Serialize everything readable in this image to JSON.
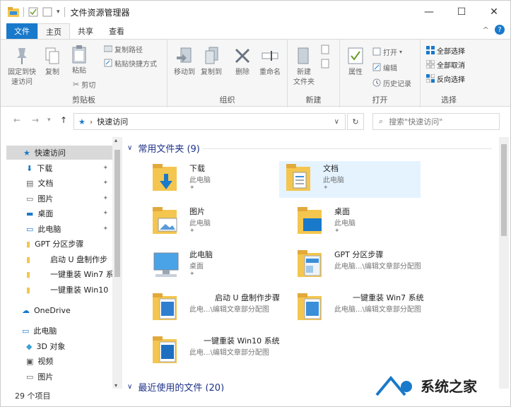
{
  "window": {
    "title": "文件资源管理器"
  },
  "tabs": [
    {
      "label": "文件"
    },
    {
      "label": "主页"
    },
    {
      "label": "共享"
    },
    {
      "label": "查看"
    }
  ],
  "ribbon": {
    "clipboard": {
      "pin": "固定到快\n速访问",
      "copy": "复制",
      "paste": "粘贴",
      "copy_path": "复制路径",
      "paste_shortcut": "粘贴快捷方式",
      "cut": "剪切",
      "label": "剪贴板"
    },
    "organize": {
      "move_to": "移动到",
      "copy_to": "复制到",
      "delete": "删除",
      "rename": "重命名",
      "label": "组织"
    },
    "new": {
      "new_folder": "新建\n文件夹",
      "label": "新建"
    },
    "open": {
      "properties": "属性",
      "open": "打开",
      "edit": "编辑",
      "history": "历史记录",
      "label": "打开"
    },
    "select": {
      "select_all": "全部选择",
      "select_none": "全部取消",
      "invert": "反向选择",
      "label": "选择"
    }
  },
  "address": {
    "path": "快速访问",
    "search_placeholder": "搜索\"快速访问\""
  },
  "nav": {
    "items": [
      {
        "label": "快速访问"
      },
      {
        "label": "下载"
      },
      {
        "label": "文档"
      },
      {
        "label": "图片"
      },
      {
        "label": "桌面"
      },
      {
        "label": "此电脑"
      },
      {
        "label": "GPT 分区步骤"
      },
      {
        "label": "启动 U 盘制作步"
      },
      {
        "label": "一键重装 Win7 系"
      },
      {
        "label": "一键重装 Win10"
      },
      {
        "label": "OneDrive"
      },
      {
        "label": "此电脑"
      },
      {
        "label": "3D 对象"
      },
      {
        "label": "视频"
      },
      {
        "label": "图片"
      }
    ]
  },
  "status": {
    "count": "29 个项目"
  },
  "content": {
    "section_title": "常用文件夹 (9)",
    "recent_title": "最近使用的文件 (20)",
    "tiles": [
      {
        "name": "下载",
        "sub": "此电脑"
      },
      {
        "name": "文档",
        "sub": "此电脑"
      },
      {
        "name": "图片",
        "sub": "此电脑"
      },
      {
        "name": "桌面",
        "sub": "此电脑"
      },
      {
        "name": "此电脑",
        "sub": "桌面"
      },
      {
        "name": "GPT 分区步骤",
        "sub": "此电脑...\\编辑文章部分配图"
      },
      {
        "name": "启动 U 盘制作步骤",
        "sub": "此电...\\编辑文章部分配图"
      },
      {
        "name": "一键重装 Win7 系统",
        "sub": "此电脑...\\编辑文章部分配图"
      },
      {
        "name": "一键重装 Win10 系统",
        "sub": "此电...\\编辑文章部分配图"
      }
    ]
  },
  "watermark": {
    "text": "系统之家"
  },
  "colors": {
    "accent": "#1979ca",
    "folder": "#f4c64f",
    "selected_tile": "#e5f3ff",
    "link": "#1e3287"
  }
}
